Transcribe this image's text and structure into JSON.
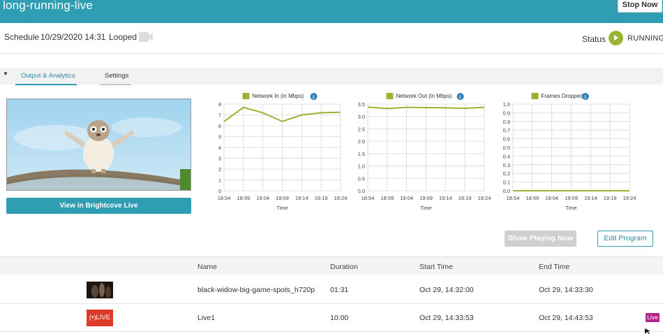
{
  "header": {
    "title": "long-running-live",
    "stop_label": "Stop Now"
  },
  "schedule": {
    "label": "Schedule",
    "datetime": "10/29/2020 14:31",
    "mode": "Looped",
    "camera_icon": "video-camera-icon"
  },
  "status": {
    "label": "Status",
    "value": "RUNNING",
    "icon": "play-icon",
    "color": "#9ab331"
  },
  "tabs": [
    {
      "label": "Output & Analytics",
      "active": true
    },
    {
      "label": "Settings",
      "active": false
    }
  ],
  "preview": {
    "button_label": "View in Brightcove Live"
  },
  "charts": [
    {
      "legend": "Network In (in Mbps)",
      "chart_data": {
        "type": "line",
        "x": [
          "18:54",
          "18:59",
          "19:04",
          "19:09",
          "19:14",
          "19:19",
          "19:24"
        ],
        "values": [
          6.4,
          7.7,
          7.2,
          6.4,
          7.0,
          7.2,
          7.25
        ],
        "yticks": [
          0,
          1,
          2,
          3,
          4,
          5,
          6,
          7,
          8
        ],
        "ylim": [
          0,
          8
        ],
        "xlabel": "Time"
      }
    },
    {
      "legend": "Network Out (in Mbps)",
      "chart_data": {
        "type": "line",
        "x": [
          "18:54",
          "18:59",
          "19:04",
          "19:09",
          "19:14",
          "19:19",
          "19:24"
        ],
        "values": [
          3.38,
          3.32,
          3.37,
          3.36,
          3.35,
          3.33,
          3.37
        ],
        "yticks": [
          0,
          0.5,
          1.0,
          1.5,
          2.0,
          2.5,
          3.0,
          3.5
        ],
        "ylim": [
          0,
          3.5
        ],
        "xlabel": "Time"
      }
    },
    {
      "legend": "Frames Dropped",
      "chart_data": {
        "type": "line",
        "x": [
          "18:54",
          "18:59",
          "19:04",
          "19:09",
          "19:14",
          "19:19",
          "19:24"
        ],
        "values": [
          0,
          0,
          0,
          0,
          0,
          0,
          0
        ],
        "yticks": [
          0,
          0.1,
          0.2,
          0.3,
          0.4,
          0.5,
          0.6,
          0.7,
          0.8,
          0.9,
          1.0
        ],
        "ylim": [
          0,
          1.0
        ],
        "xlabel": "Time"
      }
    }
  ],
  "chart_color": "#9ab331",
  "info_icon": "info-icon",
  "actions": {
    "show_playing": "Show Playing Now",
    "edit_program": "Edit Program"
  },
  "table": {
    "columns": [
      "Name",
      "Duration",
      "Start Time",
      "End Time"
    ],
    "rows": [
      {
        "name": "black-widow-big-game-spots_h720p",
        "duration": "01:31",
        "start": "Oct 29, 14:32:00",
        "end": "Oct 29, 14:33:30",
        "thumb": "video-thumbnail"
      },
      {
        "name": "Live1",
        "duration": "10:00",
        "start": "Oct 29, 14:33:53",
        "end": "Oct 29, 14:43:53",
        "thumb_label": "LIVE",
        "badge": "Live"
      }
    ]
  }
}
